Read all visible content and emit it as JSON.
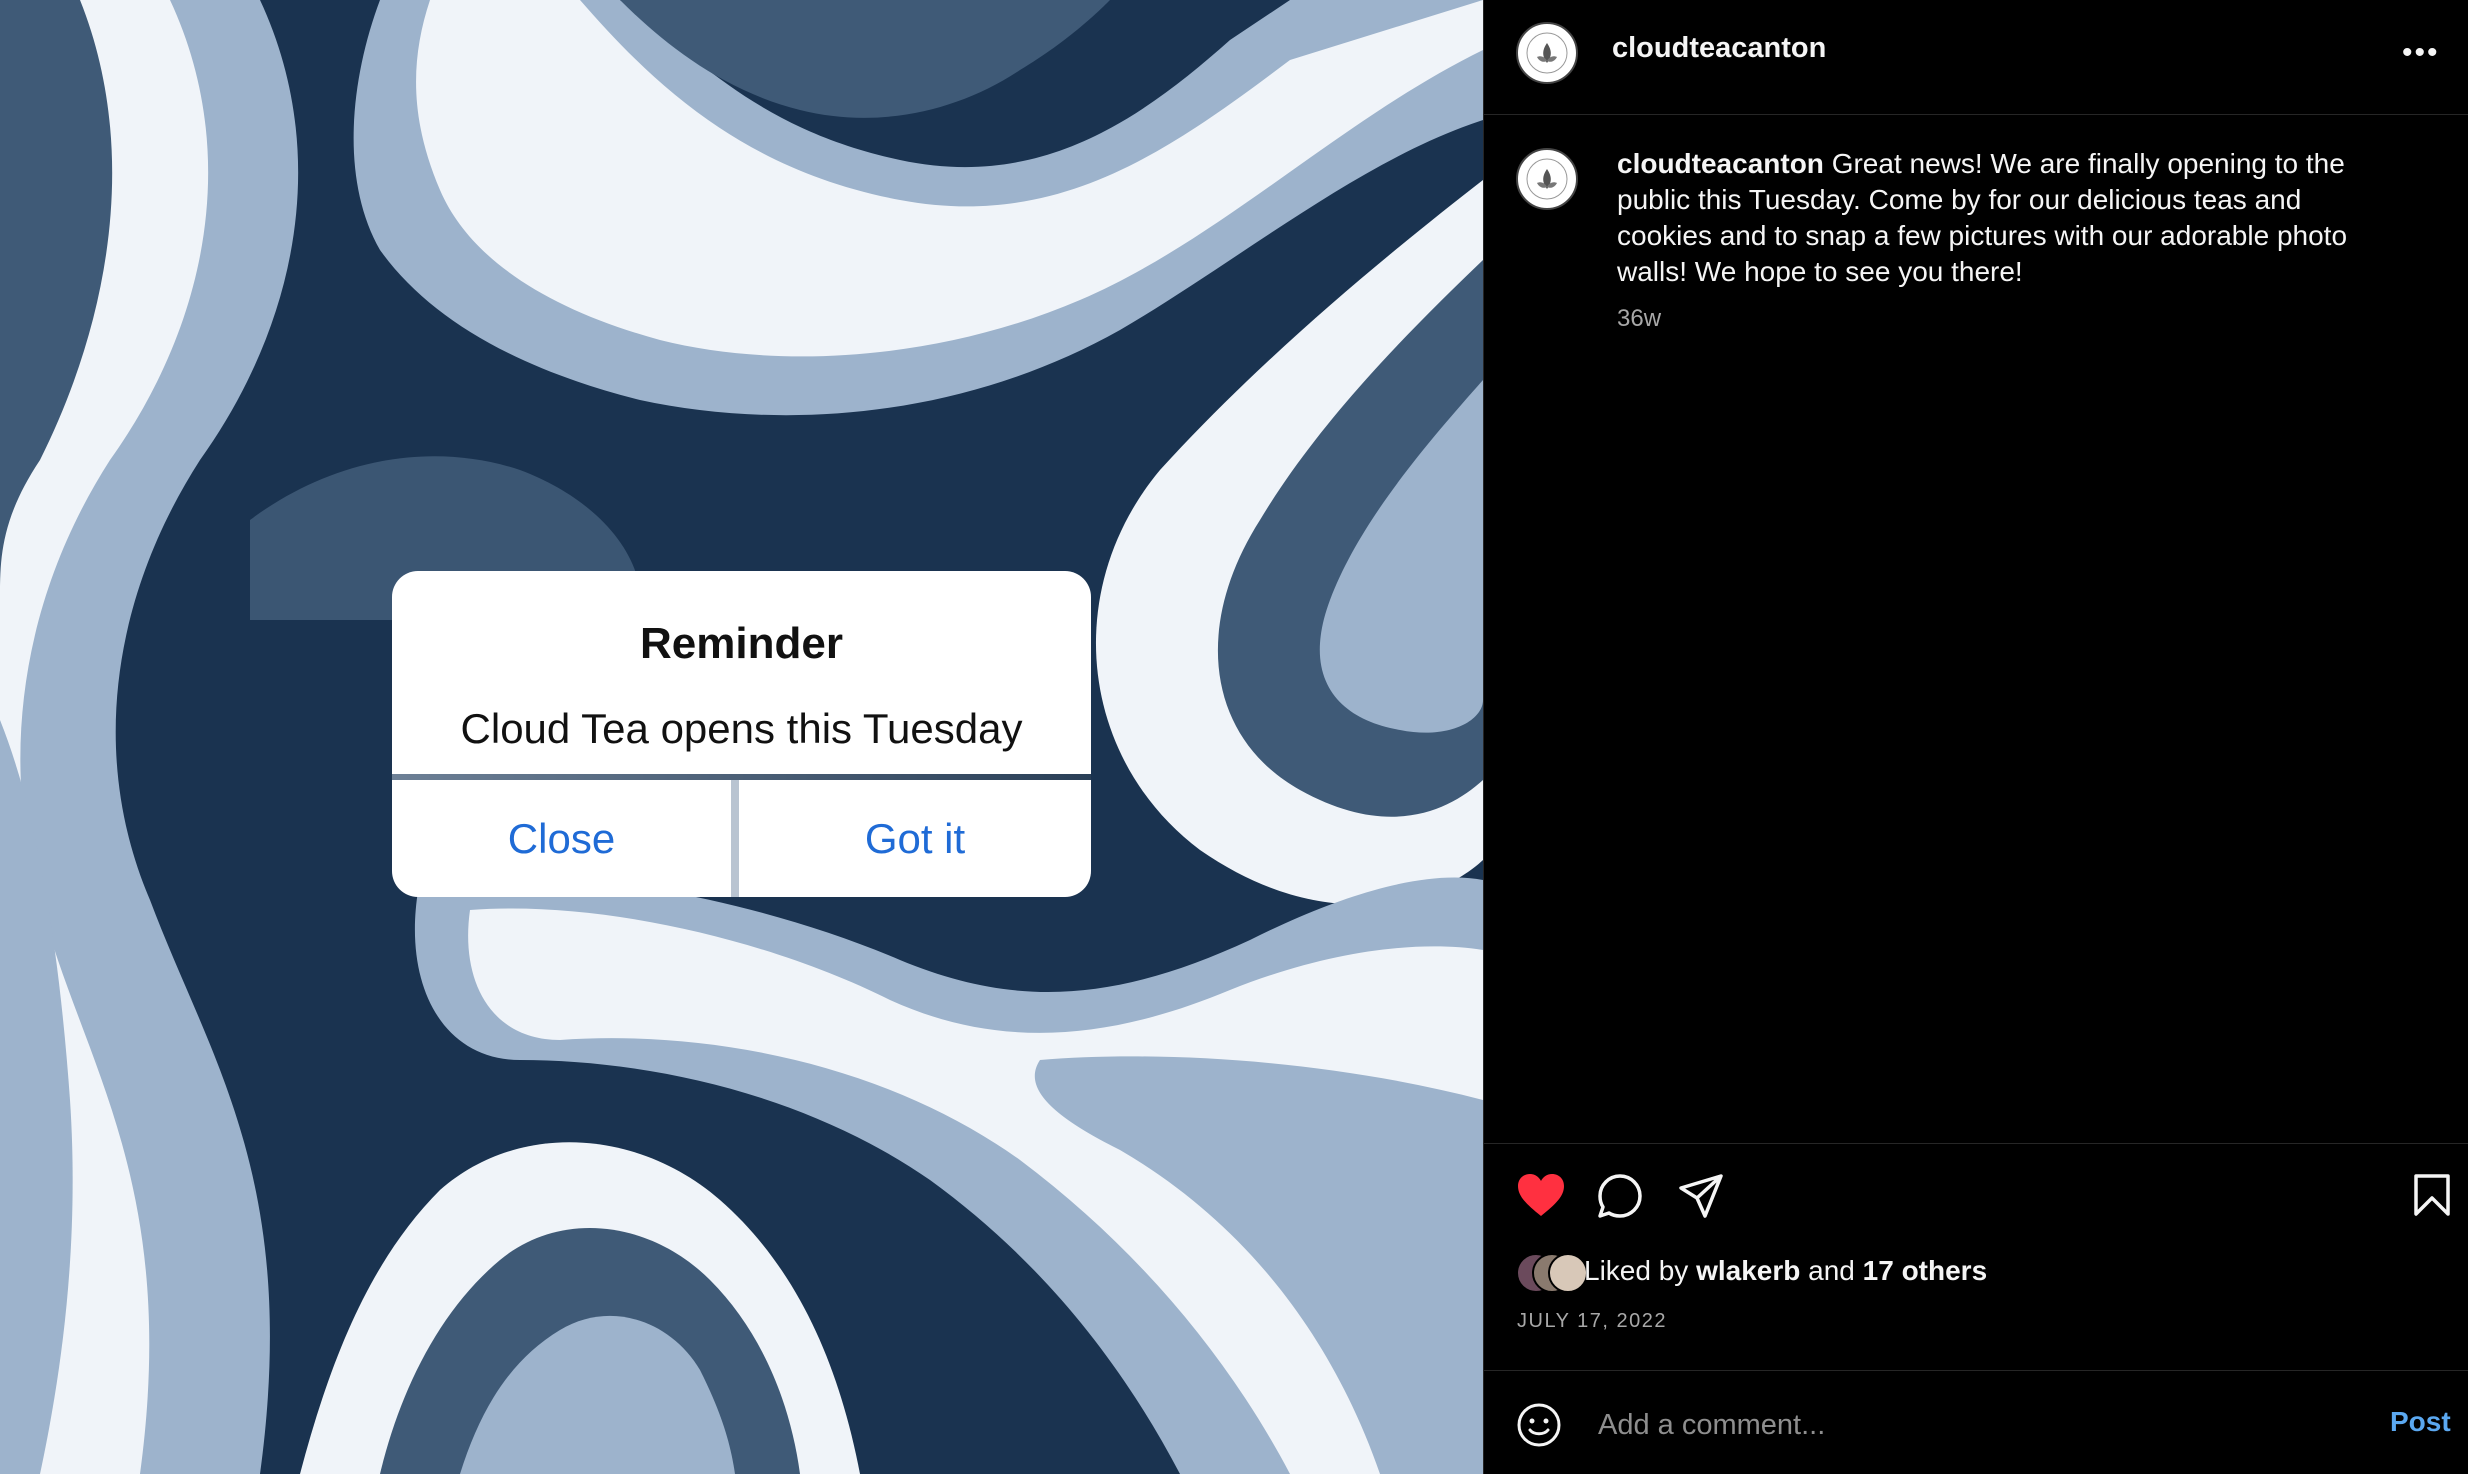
{
  "post": {
    "username": "cloudteacanton",
    "more_label": "•••",
    "caption_username": "cloudteacanton",
    "caption_text": "Great news! We are finally opening to the public this Tuesday. Come by for our delicious teas and cookies and to snap a few pictures with our adorable photo walls! We hope to see you there!",
    "age": "36w",
    "liked_prefix": "Liked by",
    "liked_user": "wlakerb",
    "liked_and": "and",
    "liked_others": "17 others",
    "date": "JULY 17, 2022",
    "liked": true
  },
  "dialog": {
    "title": "Reminder",
    "message": "Cloud Tea opens this Tuesday",
    "close_label": "Close",
    "confirm_label": "Got it"
  },
  "comment": {
    "placeholder": "Add a comment...",
    "post_label": "Post"
  },
  "colors": {
    "heart": "#ff3040",
    "post_button": "#5ba8f0",
    "dialog_button": "#1f6bd6"
  },
  "icons": [
    "heart-icon",
    "comment-icon",
    "share-icon",
    "bookmark-icon",
    "emoji-icon",
    "more-icon"
  ]
}
